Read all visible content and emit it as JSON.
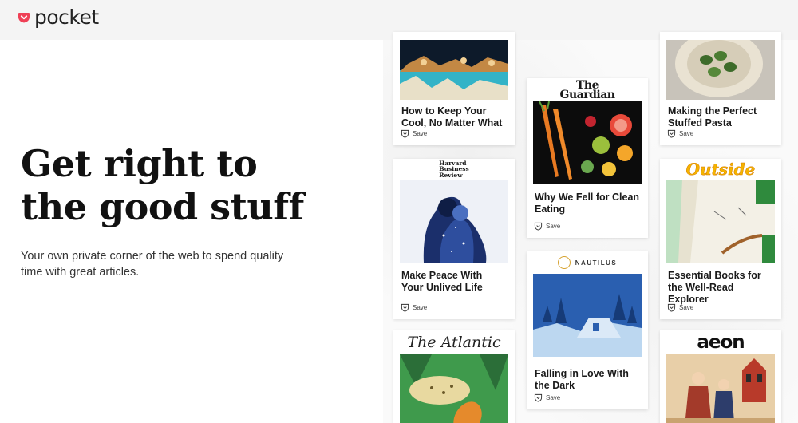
{
  "header": {
    "brand": "pocket",
    "brand_color": "#ef4056"
  },
  "hero": {
    "title_line1": "Get right to",
    "title_line2": "the good stuff",
    "subtitle": "Your own private corner of the web to spend quality time with great articles."
  },
  "cards": {
    "keep_cool": {
      "title": "How to Keep Your Cool, No Matter What",
      "save": "Save"
    },
    "clean_eating": {
      "publication_line1": "The",
      "publication_line2": "Guardian",
      "title": "Why We Fell for Clean Eating",
      "save": "Save"
    },
    "stuffed_pasta": {
      "title": "Making the Perfect Stuffed Pasta",
      "save": "Save"
    },
    "make_peace": {
      "publication_line1": "Harvard",
      "publication_line2": "Business",
      "publication_line3": "Review",
      "title": "Make Peace With Your Unlived Life",
      "save": "Save"
    },
    "love_dark": {
      "publication": "NAUTILUS",
      "title": "Falling in Love With the Dark",
      "save": "Save"
    },
    "books_explorer": {
      "publication": "Outside",
      "title": "Essential Books for the Well-Read Explorer",
      "save": "Save"
    },
    "atlantic": {
      "publication": "The Atlantic"
    },
    "aeon": {
      "publication": "aeon"
    }
  }
}
